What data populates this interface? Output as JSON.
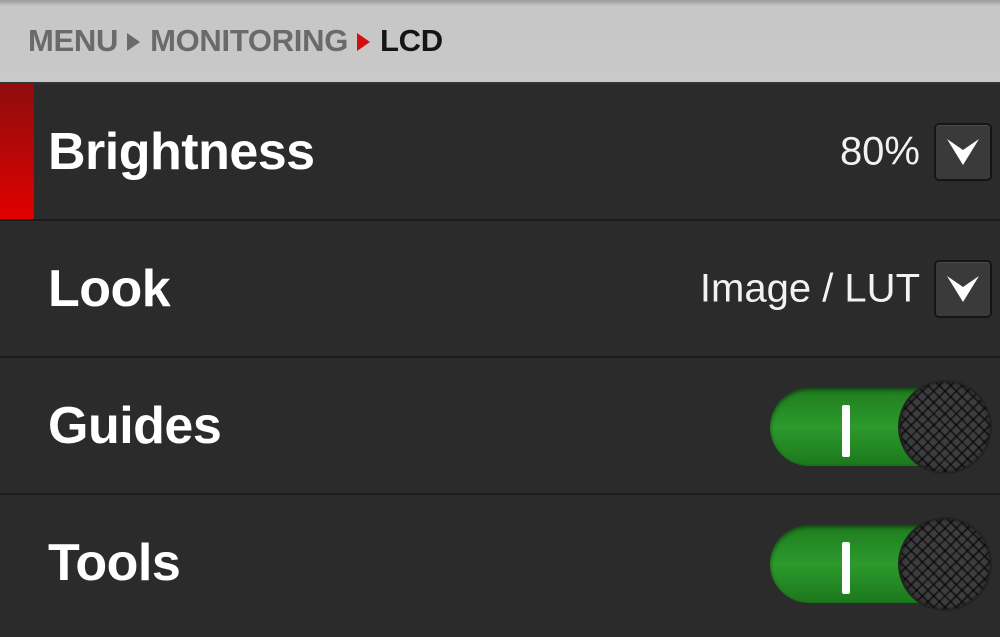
{
  "breadcrumb": {
    "items": [
      "MENU",
      "MONITORING"
    ],
    "current": "LCD"
  },
  "settings": [
    {
      "label": "Brightness",
      "value": "80%",
      "control": "dropdown",
      "selected": true
    },
    {
      "label": "Look",
      "value": "Image / LUT",
      "control": "dropdown",
      "selected": false
    },
    {
      "label": "Guides",
      "control": "toggle",
      "state": "on"
    },
    {
      "label": "Tools",
      "control": "toggle",
      "state": "on"
    }
  ],
  "colors": {
    "accent": "#e00000",
    "toggle_on": "#2c9a2c",
    "background": "#2b2b2b"
  },
  "icons": {
    "separator": "chevron-right-icon",
    "dropdown": "chevron-down-icon"
  }
}
